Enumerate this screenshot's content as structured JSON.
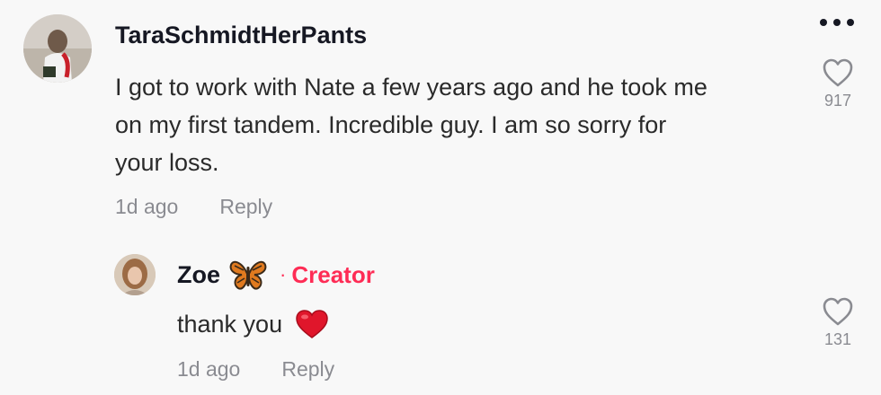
{
  "comment": {
    "username": "TaraSchmidtHerPants",
    "text_lines": [
      "I got to work with Nate a few years ago and he took me",
      "on my first tandem. Incredible guy. I am so sorry for",
      "your loss."
    ],
    "time": "1d ago",
    "reply_label": "Reply",
    "likes": "917",
    "avatar_icon": "user-avatar-photo",
    "more_icon": "more-horizontal-icon"
  },
  "reply": {
    "username": "Zoe",
    "username_emoji": "butterfly-emoji",
    "separator": "·",
    "badge": "Creator",
    "text": "thank you",
    "text_emoji": "red-heart-emoji",
    "time": "1d ago",
    "reply_label": "Reply",
    "likes": "131",
    "avatar_icon": "creator-avatar-photo"
  },
  "colors": {
    "background": "#f8f8f8",
    "creator_accent": "#fe2c55",
    "muted_text": "#8a8b91",
    "primary_text": "#161823"
  }
}
